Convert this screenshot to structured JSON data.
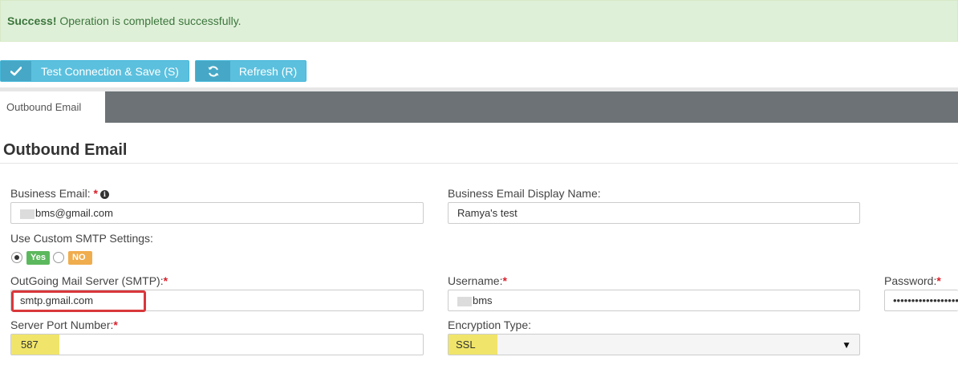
{
  "alert": {
    "strong": "Success!",
    "message": " Operation is completed successfully."
  },
  "toolbar": {
    "save_label": "Test Connection & Save (S)",
    "refresh_label": "Refresh (R)"
  },
  "tabs": [
    {
      "label": "Outbound Email",
      "active": true
    }
  ],
  "section": {
    "title": "Outbound Email"
  },
  "form": {
    "business_email": {
      "label": "Business Email:",
      "required": "*",
      "value": "bms@gmail.com"
    },
    "display_name": {
      "label": "Business Email Display Name:",
      "value": "Ramya's test"
    },
    "custom_smtp": {
      "label": "Use Custom SMTP Settings:",
      "yes": "Yes",
      "no": "NO",
      "selected": "Yes"
    },
    "smtp_server": {
      "label": "OutGoing Mail Server (SMTP):",
      "required": "*",
      "value": "smtp.gmail.com"
    },
    "username": {
      "label": "Username:",
      "required": "*",
      "value": "bms"
    },
    "password": {
      "label": "Password:",
      "required": "*",
      "value": "••••••••••••••••••"
    },
    "port": {
      "label": "Server Port Number:",
      "required": "*",
      "value": "587"
    },
    "encryption": {
      "label": "Encryption Type:",
      "value": "SSL"
    }
  },
  "colors": {
    "success_bg": "#dff0d8",
    "button_bg": "#5bc0de",
    "tabbar_bg": "#6c7276",
    "required": "#d9202b",
    "highlight_red": "#d9373b",
    "highlight_yellow": "#f0e56a"
  }
}
